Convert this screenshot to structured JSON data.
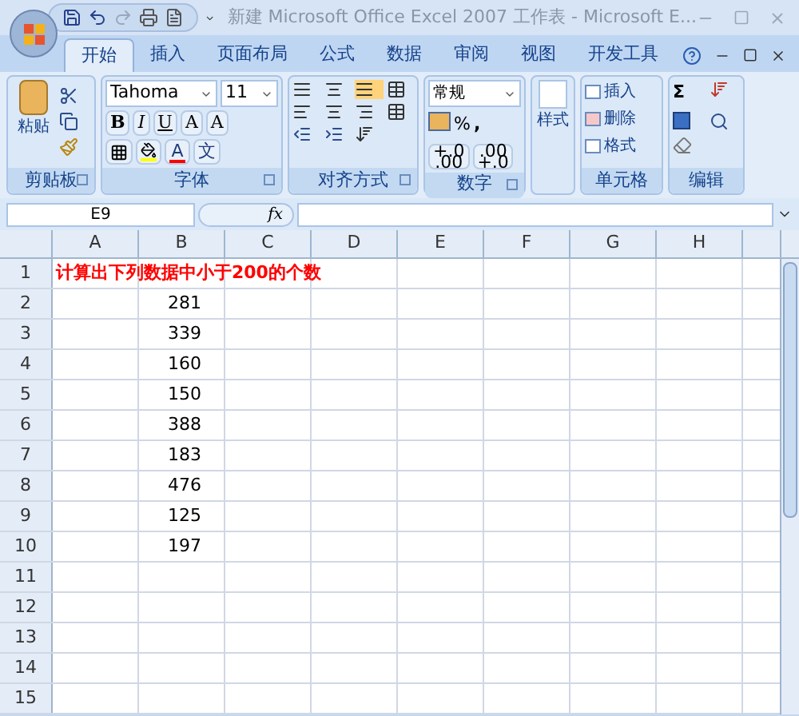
{
  "window": {
    "title": "新建 Microsoft Office Excel 2007 工作表 - Microsoft E..."
  },
  "tabs": [
    {
      "label": "开始",
      "selected": true
    },
    {
      "label": "插入",
      "selected": false
    },
    {
      "label": "页面布局",
      "selected": false
    },
    {
      "label": "公式",
      "selected": false
    },
    {
      "label": "数据",
      "selected": false
    },
    {
      "label": "审阅",
      "selected": false
    },
    {
      "label": "视图",
      "selected": false
    },
    {
      "label": "开发工具",
      "selected": false
    }
  ],
  "ribbon": {
    "clipboard": {
      "label": "剪贴板",
      "paste": "粘贴"
    },
    "font": {
      "label": "字体",
      "font_name": "Tahoma",
      "font_size": "11",
      "bold": "B",
      "italic": "I",
      "underline": "U",
      "grow": "A",
      "shrink": "A",
      "font_color": "A",
      "phonetic": "文"
    },
    "alignment": {
      "label": "对齐方式"
    },
    "number": {
      "label": "数字",
      "format": "常规",
      "percent": "%",
      "comma": ",",
      "increase_decimal": "+.0\n.00",
      "decrease_decimal": ".00\n+.0"
    },
    "styles": {
      "button": "样式"
    },
    "cells": {
      "label": "单元格",
      "items": [
        "插入",
        "删除",
        "格式"
      ]
    },
    "editing": {
      "label": "编辑",
      "sum": "Σ"
    }
  },
  "formula_bar": {
    "name_box": "E9",
    "function_label": "fx"
  },
  "sheet": {
    "columns": [
      "A",
      "B",
      "C",
      "D",
      "E",
      "F",
      "G",
      "H"
    ],
    "rows": [
      {
        "label": "1",
        "heading": "计算出下列数据中小于200的个数"
      },
      {
        "label": "2",
        "b": "281"
      },
      {
        "label": "3",
        "b": "339"
      },
      {
        "label": "4",
        "b": "160"
      },
      {
        "label": "5",
        "b": "150"
      },
      {
        "label": "6",
        "b": "388"
      },
      {
        "label": "7",
        "b": "183"
      },
      {
        "label": "8",
        "b": "476"
      },
      {
        "label": "9",
        "b": "125"
      },
      {
        "label": "10",
        "b": "197"
      },
      {
        "label": "11"
      },
      {
        "label": "12"
      },
      {
        "label": "13"
      },
      {
        "label": "14"
      },
      {
        "label": "15"
      }
    ]
  }
}
